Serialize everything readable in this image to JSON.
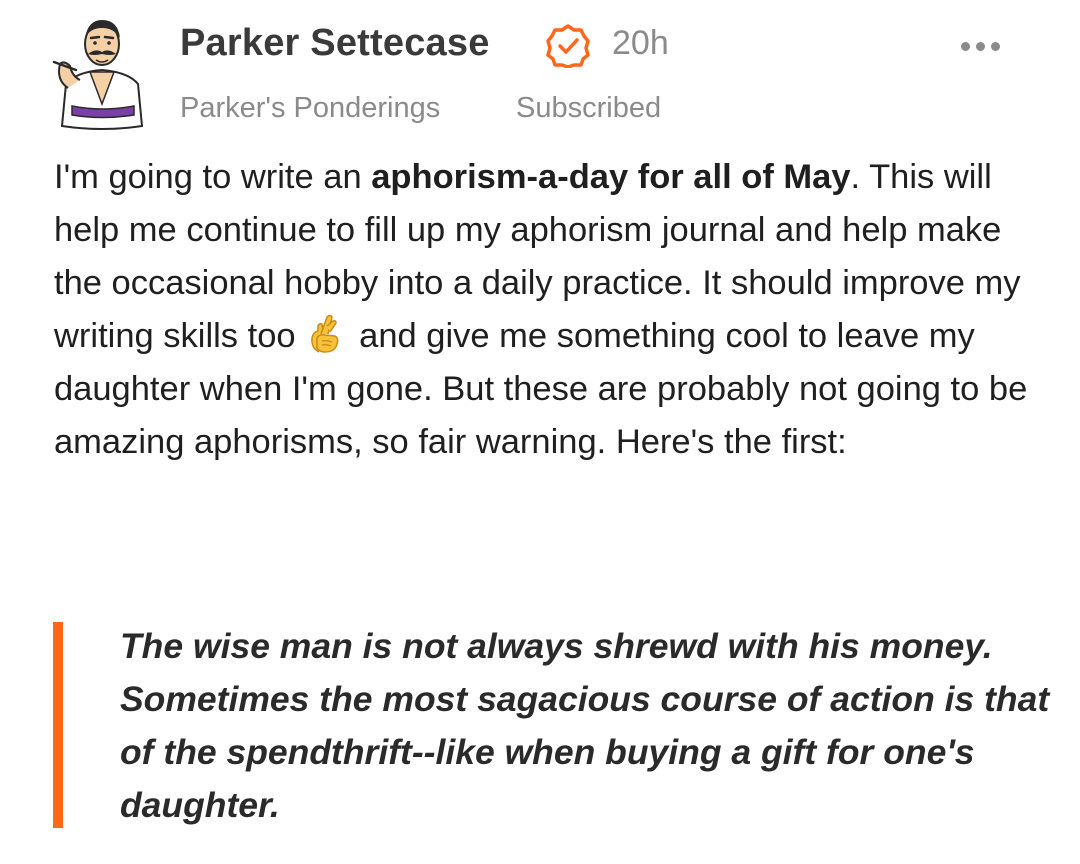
{
  "post": {
    "author": {
      "name": "Parker Settecase",
      "avatar_icon": "cartoon-man-in-gi-icon",
      "verified_icon": "verified-badge-icon"
    },
    "timestamp": "20h",
    "publication": "Parker's Ponderings",
    "subscription_status": "Subscribed",
    "more_icon": "ellipsis-icon",
    "body": {
      "part1": "I'm going to write an ",
      "bold": "aphorism-a-day for all of May",
      "part2": ". This will help me continue to fill up my aphorism journal and help make the occasional hobby into a daily practice. It should improve my writing skills too ",
      "emoji": "crossed-fingers-icon",
      "part3": "and give me something cool to leave my daughter when I'm gone. But these are probably not going to be amazing aphorisms, so fair warning. Here's the first:"
    },
    "quote": "The wise man is not always shrewd with his money. Sometimes the most sagacious course of action is that of the spendthrift--like when buying a gift for one's daughter."
  },
  "colors": {
    "accent": "#ff6719",
    "muted_text": "#8a8a8a",
    "body_text": "#1f1f1f"
  }
}
